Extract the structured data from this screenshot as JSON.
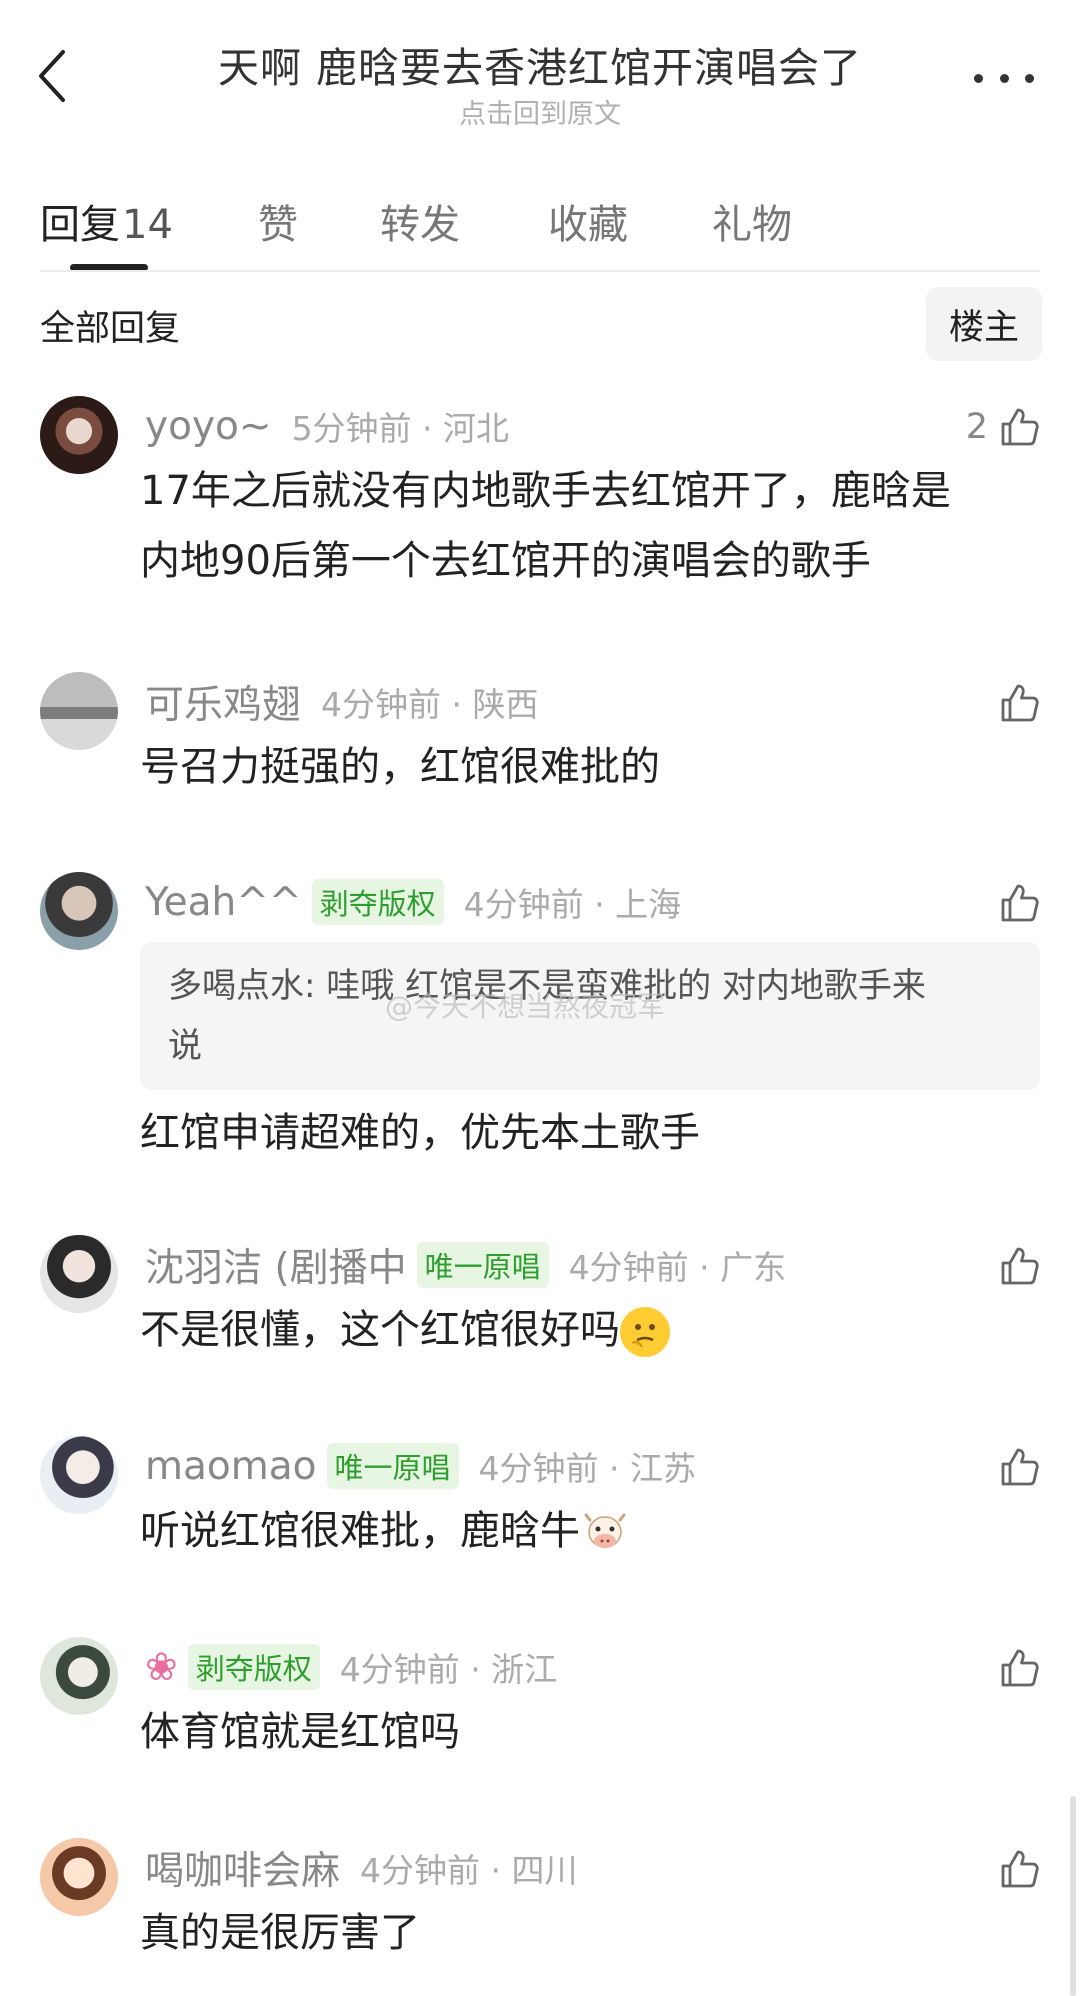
{
  "header": {
    "title": "天啊 鹿晗要去香港红馆开演唱会了",
    "subtitle": "点击回到原文"
  },
  "tabs": [
    {
      "label": "回复",
      "count": "14"
    },
    {
      "label": "赞"
    },
    {
      "label": "转发"
    },
    {
      "label": "收藏"
    },
    {
      "label": "礼物"
    }
  ],
  "section": {
    "title": "全部回复",
    "owner_button": "楼主"
  },
  "watermark": "@今天不想当熬夜冠军",
  "comments": [
    {
      "username": "yoyo~",
      "time": "5分钟前 · 河北",
      "likes": "2",
      "text_line1": "17年之后就没有内地歌手去红馆开了，鹿晗是",
      "text_line2": "内地90后第一个去红馆开的演唱会的歌手"
    },
    {
      "username": "可乐鸡翅",
      "time": "4分钟前 · 陕西",
      "text": "号召力挺强的，红馆很难批的"
    },
    {
      "username": "Yeah^^",
      "badge": "剥夺版权",
      "time": "4分钟前 · 上海",
      "quote_line1": "多喝点水: 哇哦 红馆是不是蛮难批的 对内地歌手来",
      "quote_line2": "说",
      "text": "红馆申请超难的，优先本土歌手"
    },
    {
      "username": "沈羽洁 (剧播中",
      "badge": "唯一原唱",
      "time": "4分钟前 · 广东",
      "text": "不是很懂，这个红馆很好吗"
    },
    {
      "username": "maomao",
      "badge": "唯一原唱",
      "time": "4分钟前 · 江苏",
      "text": "听说红馆很难批，鹿晗牛"
    },
    {
      "username": "❀",
      "badge": "剥夺版权",
      "time": "4分钟前 · 浙江",
      "text": "体育馆就是红馆吗"
    },
    {
      "username": "喝咖啡会麻",
      "time": "4分钟前 · 四川",
      "text": "真的是很厉害了"
    }
  ]
}
